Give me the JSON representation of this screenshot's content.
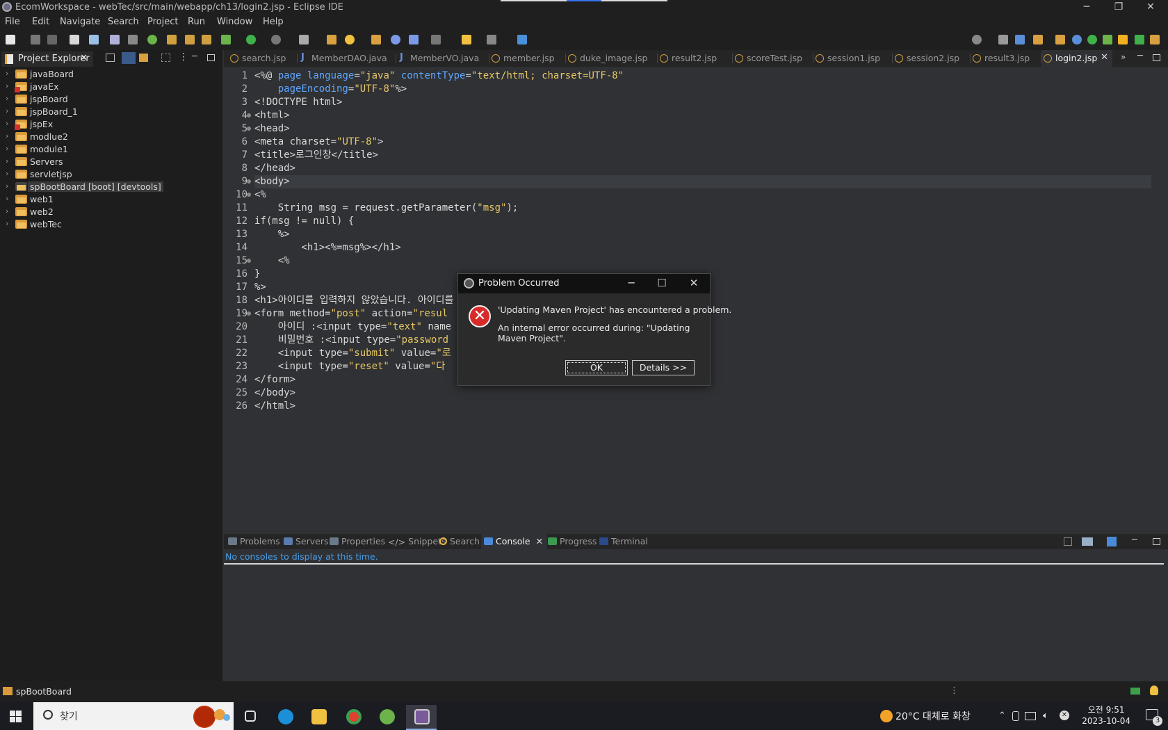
{
  "window": {
    "title": "EcomWorkspace - webTec/src/main/webapp/ch13/login2.jsp - Eclipse IDE",
    "minimize": "─",
    "maximize": "❐",
    "close": "✕"
  },
  "menu": [
    "File",
    "Edit",
    "Navigate",
    "Search",
    "Project",
    "Run",
    "Window",
    "Help"
  ],
  "project_explorer": {
    "title": "Project Explorer",
    "close": "✕",
    "items": [
      {
        "label": "javaBoard",
        "error": false
      },
      {
        "label": "javaEx",
        "error": true
      },
      {
        "label": "jspBoard",
        "error": false
      },
      {
        "label": "jspBoard_1",
        "error": false
      },
      {
        "label": "jspEx",
        "error": true
      },
      {
        "label": "modlue2",
        "error": false
      },
      {
        "label": "module1",
        "error": false
      },
      {
        "label": "Servers",
        "error": false
      },
      {
        "label": "servletjsp",
        "error": false
      },
      {
        "label": "spBootBoard [boot] [devtools]",
        "error": false,
        "selected": true
      },
      {
        "label": "web1",
        "error": false
      },
      {
        "label": "web2",
        "error": false
      },
      {
        "label": "webTec",
        "error": false
      }
    ]
  },
  "editor_tabs": [
    {
      "label": "search.jsp",
      "icon": "jsp"
    },
    {
      "label": "MemberDAO.java",
      "icon": "java"
    },
    {
      "label": "MemberVO.java",
      "icon": "java"
    },
    {
      "label": "member.jsp",
      "icon": "jsp"
    },
    {
      "label": "duke_image.jsp",
      "icon": "jsp"
    },
    {
      "label": "result2.jsp",
      "icon": "jsp"
    },
    {
      "label": "scoreTest.jsp",
      "icon": "jsp"
    },
    {
      "label": "session1.jsp",
      "icon": "jsp"
    },
    {
      "label": "session2.jsp",
      "icon": "jsp"
    },
    {
      "label": "result3.jsp",
      "icon": "jsp"
    },
    {
      "label": "login2.jsp",
      "icon": "jsp",
      "active": true
    }
  ],
  "active_tab_close": "✕",
  "editor": {
    "line_numbers": [
      "1",
      "2",
      "3",
      "4",
      "5",
      "6",
      "7",
      "8",
      "9",
      "10",
      "11",
      "12",
      "13",
      "14",
      "15",
      "16",
      "17",
      "18",
      "19",
      "20",
      "21",
      "22",
      "23",
      "24",
      "25",
      "26"
    ],
    "current_line": 9,
    "lines": [
      "<%@ page language=\"java\" contentType=\"text/html; charset=UTF-8\"",
      "    pageEncoding=\"UTF-8\"%>",
      "<!DOCTYPE html>",
      "<html>",
      "<head>",
      "<meta charset=\"UTF-8\">",
      "<title>로그인창</title>",
      "</head>",
      "<body>",
      "<%",
      "    String msg = request.getParameter(\"msg\");",
      "if(msg != null) {",
      "    %>",
      "        <h1><%=msg%></h1>",
      "    <%",
      "}",
      "%>",
      "<h1>아이디를 입력하지 않았습니다. 아이디를 입",
      "<form method=\"post\" action=\"resul",
      "    아이디 :<input type=\"text\" name",
      "    비밀번호 :<input type=\"password",
      "    <input type=\"submit\" value=\"로",
      "    <input type=\"reset\" value=\"다",
      "</form>",
      "</body>",
      "</html>"
    ]
  },
  "bottom_tabs": [
    {
      "label": "Problems"
    },
    {
      "label": "Servers"
    },
    {
      "label": "Properties"
    },
    {
      "label": "Snippets"
    },
    {
      "label": "Search"
    },
    {
      "label": "Console",
      "active": true
    },
    {
      "label": "Progress"
    },
    {
      "label": "Terminal"
    }
  ],
  "console_close": "✕",
  "console_message": "No consoles to display at this time.",
  "dialog": {
    "title": "Problem Occurred",
    "minimize": "─",
    "maximize": "☐",
    "close": "✕",
    "error_glyph": "✕",
    "message": "'Updating Maven Project' has encountered a problem.",
    "detail": "An internal error occurred during: \"Updating Maven Project\".",
    "ok_label": "OK",
    "details_label": "Details >>"
  },
  "status_bar": {
    "project": "spBootBoard"
  },
  "taskbar": {
    "search_placeholder": "찾기",
    "weather": "20°C  대체로 화창",
    "time": "오전 9:51",
    "date": "2023-10-04",
    "notification_count": "3"
  },
  "colors": {
    "background": "#2f3134",
    "error": "#d92a2a",
    "accent": "#3574f0",
    "string": "#e8c766",
    "keyword": "#5fa6ff"
  }
}
